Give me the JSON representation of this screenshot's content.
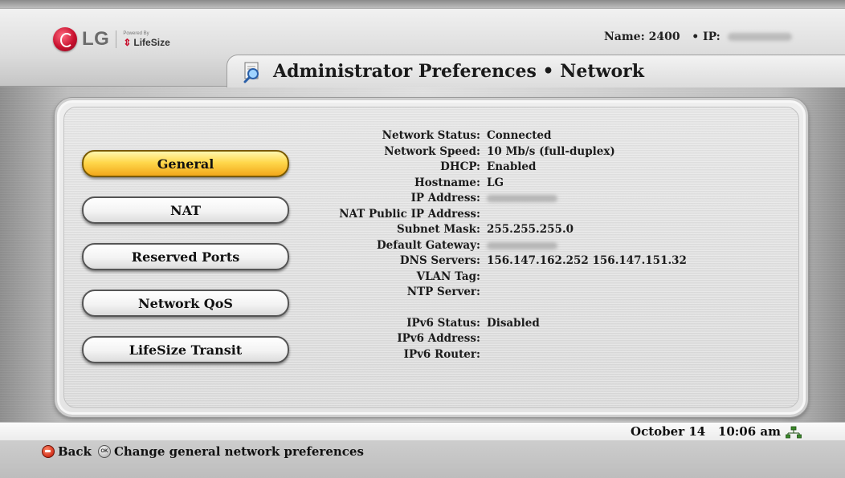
{
  "header": {
    "brand": "LG",
    "powered_by": "Powered By",
    "partner": "LifeSize",
    "device_name_label": "Name:",
    "device_name": "2400",
    "ip_label": "• IP:",
    "title": "Administrator Preferences • Network"
  },
  "menu": [
    {
      "label": "General",
      "selected": true
    },
    {
      "label": "NAT",
      "selected": false
    },
    {
      "label": "Reserved Ports",
      "selected": false
    },
    {
      "label": "Network QoS",
      "selected": false
    },
    {
      "label": "LifeSize Transit",
      "selected": false
    }
  ],
  "info": [
    {
      "label": "Network Status:",
      "value": "Connected"
    },
    {
      "label": "Network Speed:",
      "value": "10 Mb/s (full-duplex)"
    },
    {
      "label": "DHCP:",
      "value": "Enabled"
    },
    {
      "label": "Hostname:",
      "value": "LG"
    },
    {
      "label": "IP Address:",
      "value": "",
      "blurred": true
    },
    {
      "label": "NAT Public IP Address:",
      "value": ""
    },
    {
      "label": "Subnet Mask:",
      "value": "255.255.255.0"
    },
    {
      "label": "Default Gateway:",
      "value": "",
      "blurred": true
    },
    {
      "label": "DNS Servers:",
      "value": "156.147.162.252 156.147.151.32"
    },
    {
      "label": "VLAN Tag:",
      "value": ""
    },
    {
      "label": "NTP Server:",
      "value": ""
    },
    {
      "label": "IPv6 Status:",
      "value": "Disabled"
    },
    {
      "label": "IPv6 Address:",
      "value": ""
    },
    {
      "label": "IPv6 Router:",
      "value": ""
    }
  ],
  "status": {
    "date": "October 14",
    "time": "10:06 am"
  },
  "footer": {
    "back_label": "Back",
    "ok_hint": "Change general network preferences",
    "ok_icon_text": "OK"
  }
}
